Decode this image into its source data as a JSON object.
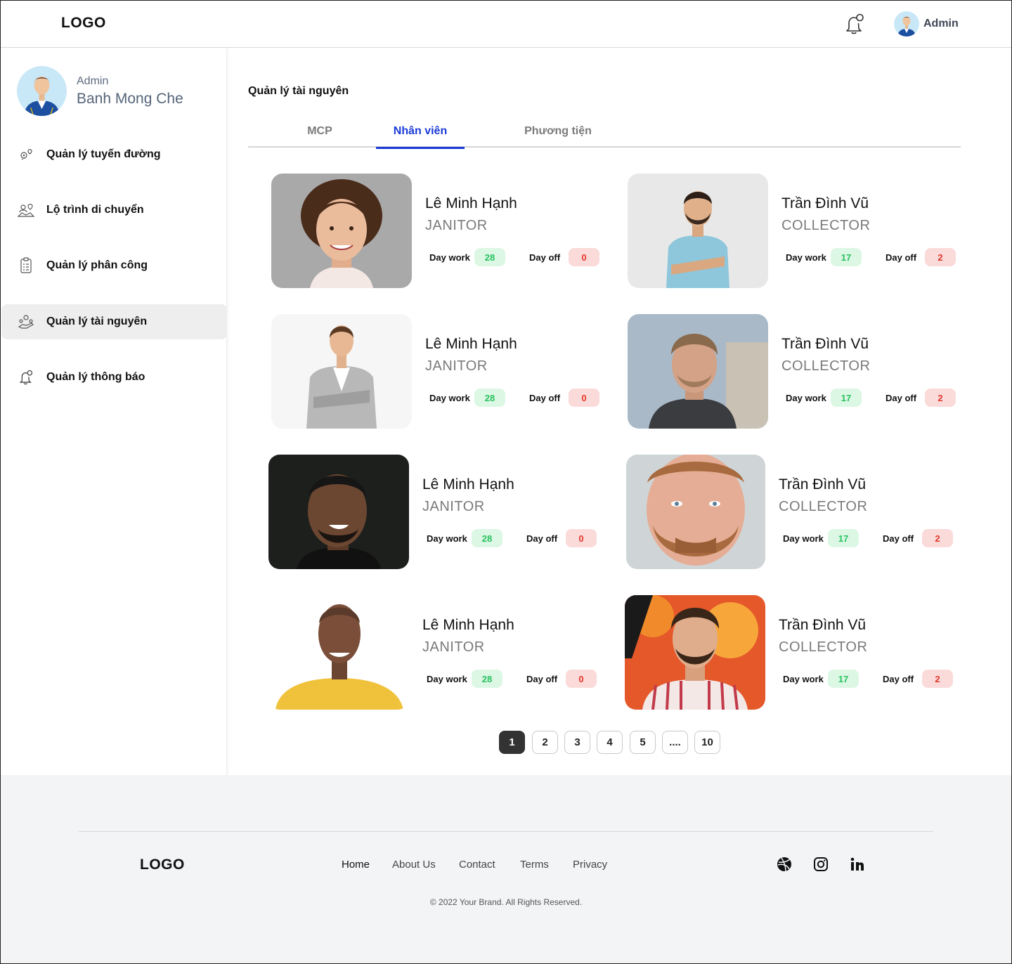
{
  "header": {
    "logo": "LOGO",
    "user_name": "Admin",
    "icons": [
      "bell-icon",
      "avatar"
    ]
  },
  "sidebar": {
    "profile": {
      "role": "Admin",
      "name": "Banh Mong Che"
    },
    "items": [
      {
        "label": "Quản lý tuyến đường",
        "icon": "route-pin-icon",
        "active": false
      },
      {
        "label": "Lộ trình di chuyển",
        "icon": "map-people-icon",
        "active": false
      },
      {
        "label": "Quản lý phân công",
        "icon": "clipboard-icon",
        "active": false
      },
      {
        "label": "Quản lý tài nguyên",
        "icon": "resource-hand-icon",
        "active": true
      },
      {
        "label": "Quản lý thông báo",
        "icon": "bell-icon",
        "active": false
      }
    ]
  },
  "main": {
    "title": "Quản lý tài nguyên",
    "tabs": [
      {
        "label": "MCP",
        "active": false
      },
      {
        "label": "Nhân viên",
        "active": true
      },
      {
        "label": "Phương tiện",
        "active": false
      }
    ],
    "stat_labels": {
      "day_work": "Day work",
      "day_off": "Day off"
    },
    "employees": [
      {
        "name": "Lê Minh Hạnh",
        "role": "JANITOR",
        "day_work": "28",
        "day_off": "0"
      },
      {
        "name": "Trần Đình Vũ",
        "role": "COLLECTOR",
        "day_work": "17",
        "day_off": "2"
      },
      {
        "name": "Lê Minh Hạnh",
        "role": "JANITOR",
        "day_work": "28",
        "day_off": "0"
      },
      {
        "name": "Trần Đình Vũ",
        "role": "COLLECTOR",
        "day_work": "17",
        "day_off": "2"
      },
      {
        "name": "Lê Minh Hạnh",
        "role": "JANITOR",
        "day_work": "28",
        "day_off": "0"
      },
      {
        "name": "Trần Đình Vũ",
        "role": "COLLECTOR",
        "day_work": "17",
        "day_off": "2"
      },
      {
        "name": "Lê Minh Hạnh",
        "role": "JANITOR",
        "day_work": "28",
        "day_off": "0"
      },
      {
        "name": "Trần Đình Vũ",
        "role": "COLLECTOR",
        "day_work": "17",
        "day_off": "2"
      }
    ]
  },
  "pagination": {
    "pages": [
      "1",
      "2",
      "3",
      "4",
      "5",
      "....",
      "10"
    ],
    "current": "1"
  },
  "footer": {
    "logo": "LOGO",
    "links": [
      "Home",
      "About Us",
      "Contact",
      "Terms",
      "Privacy"
    ],
    "social": [
      "dribbble-icon",
      "instagram-icon",
      "linkedin-icon"
    ],
    "copyright": "© 2022 Your Brand. All Rights Reserved."
  },
  "colors": {
    "accent": "#1b3bd9",
    "badge_green_bg": "#dcf7e4",
    "badge_green_text": "#27c25f",
    "badge_red_bg": "#fbdada",
    "badge_red_text": "#e0392b",
    "active_page": "#333333",
    "footer_bg": "#f3f4f6"
  }
}
